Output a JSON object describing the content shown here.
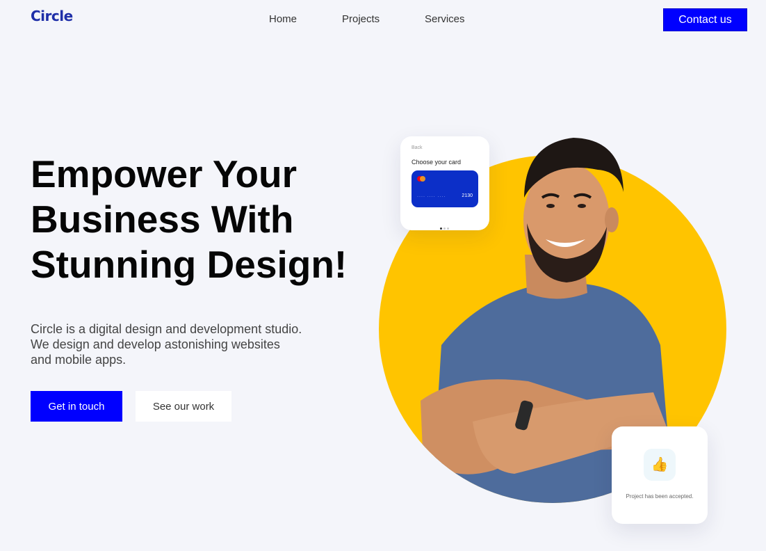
{
  "header": {
    "logo": "Circle",
    "nav": [
      {
        "label": "Home"
      },
      {
        "label": "Projects"
      },
      {
        "label": "Services"
      }
    ],
    "contact_label": "Contact us"
  },
  "hero": {
    "title_lines": [
      "Empower Your",
      "Business With",
      "Stunning Design!"
    ],
    "description_lines": [
      "Circle is a digital design and development studio.",
      "We design and develop astonishing websites",
      "and mobile apps."
    ],
    "primary_button": "Get in touch",
    "secondary_button": "See our work"
  },
  "card_widget": {
    "back_label": "Back",
    "title": "Choose your card",
    "card_masked": "···· ···· ····",
    "card_last4": "2130"
  },
  "approval_widget": {
    "icon": "thumbs-up-icon",
    "text": "Project has been accepted."
  },
  "colors": {
    "accent": "#0000ff",
    "logo": "#1f2fa8",
    "circle": "#ffc400",
    "card": "#0c2fc8",
    "background": "#f4f5fa"
  }
}
